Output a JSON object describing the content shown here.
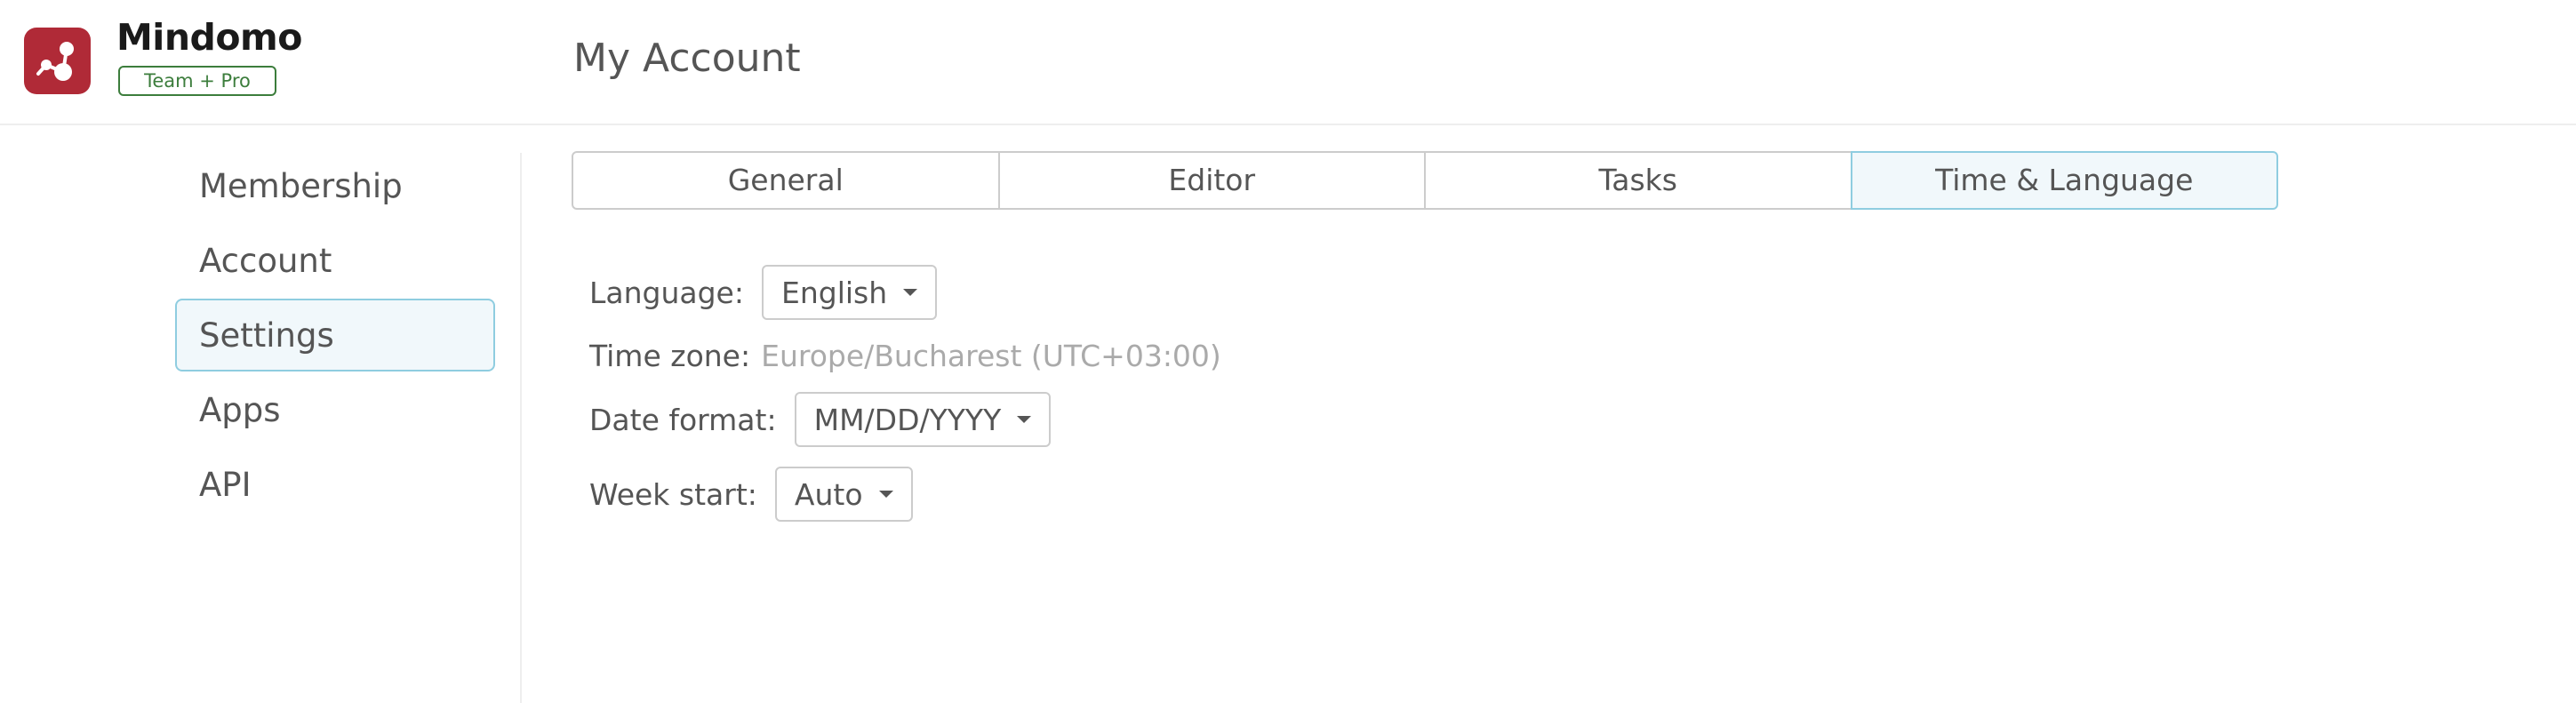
{
  "header": {
    "brand": "Mindomo",
    "plan": "Team + Pro",
    "page_title": "My Account",
    "logo_icon": "mindomo-logo-icon",
    "logo_color": "#b02a37"
  },
  "sidebar": {
    "items": [
      {
        "label": "Membership",
        "active": false
      },
      {
        "label": "Account",
        "active": false
      },
      {
        "label": "Settings",
        "active": true
      },
      {
        "label": "Apps",
        "active": false
      },
      {
        "label": "API",
        "active": false
      }
    ]
  },
  "tabs": [
    {
      "label": "General",
      "active": false
    },
    {
      "label": "Editor",
      "active": false
    },
    {
      "label": "Tasks",
      "active": false
    },
    {
      "label": "Time & Language",
      "active": true
    }
  ],
  "form": {
    "language": {
      "label": "Language:",
      "value": "English"
    },
    "timezone": {
      "label": "Time zone:",
      "value": "Europe/Bucharest (UTC+03:00)"
    },
    "date_format": {
      "label": "Date format:",
      "value": "MM/DD/YYYY"
    },
    "week_start": {
      "label": "Week start:",
      "value": "Auto"
    }
  },
  "colors": {
    "accent_border": "#8fcde0",
    "accent_bg": "#f1f8fb",
    "plan_badge": "#3c7d3c"
  }
}
